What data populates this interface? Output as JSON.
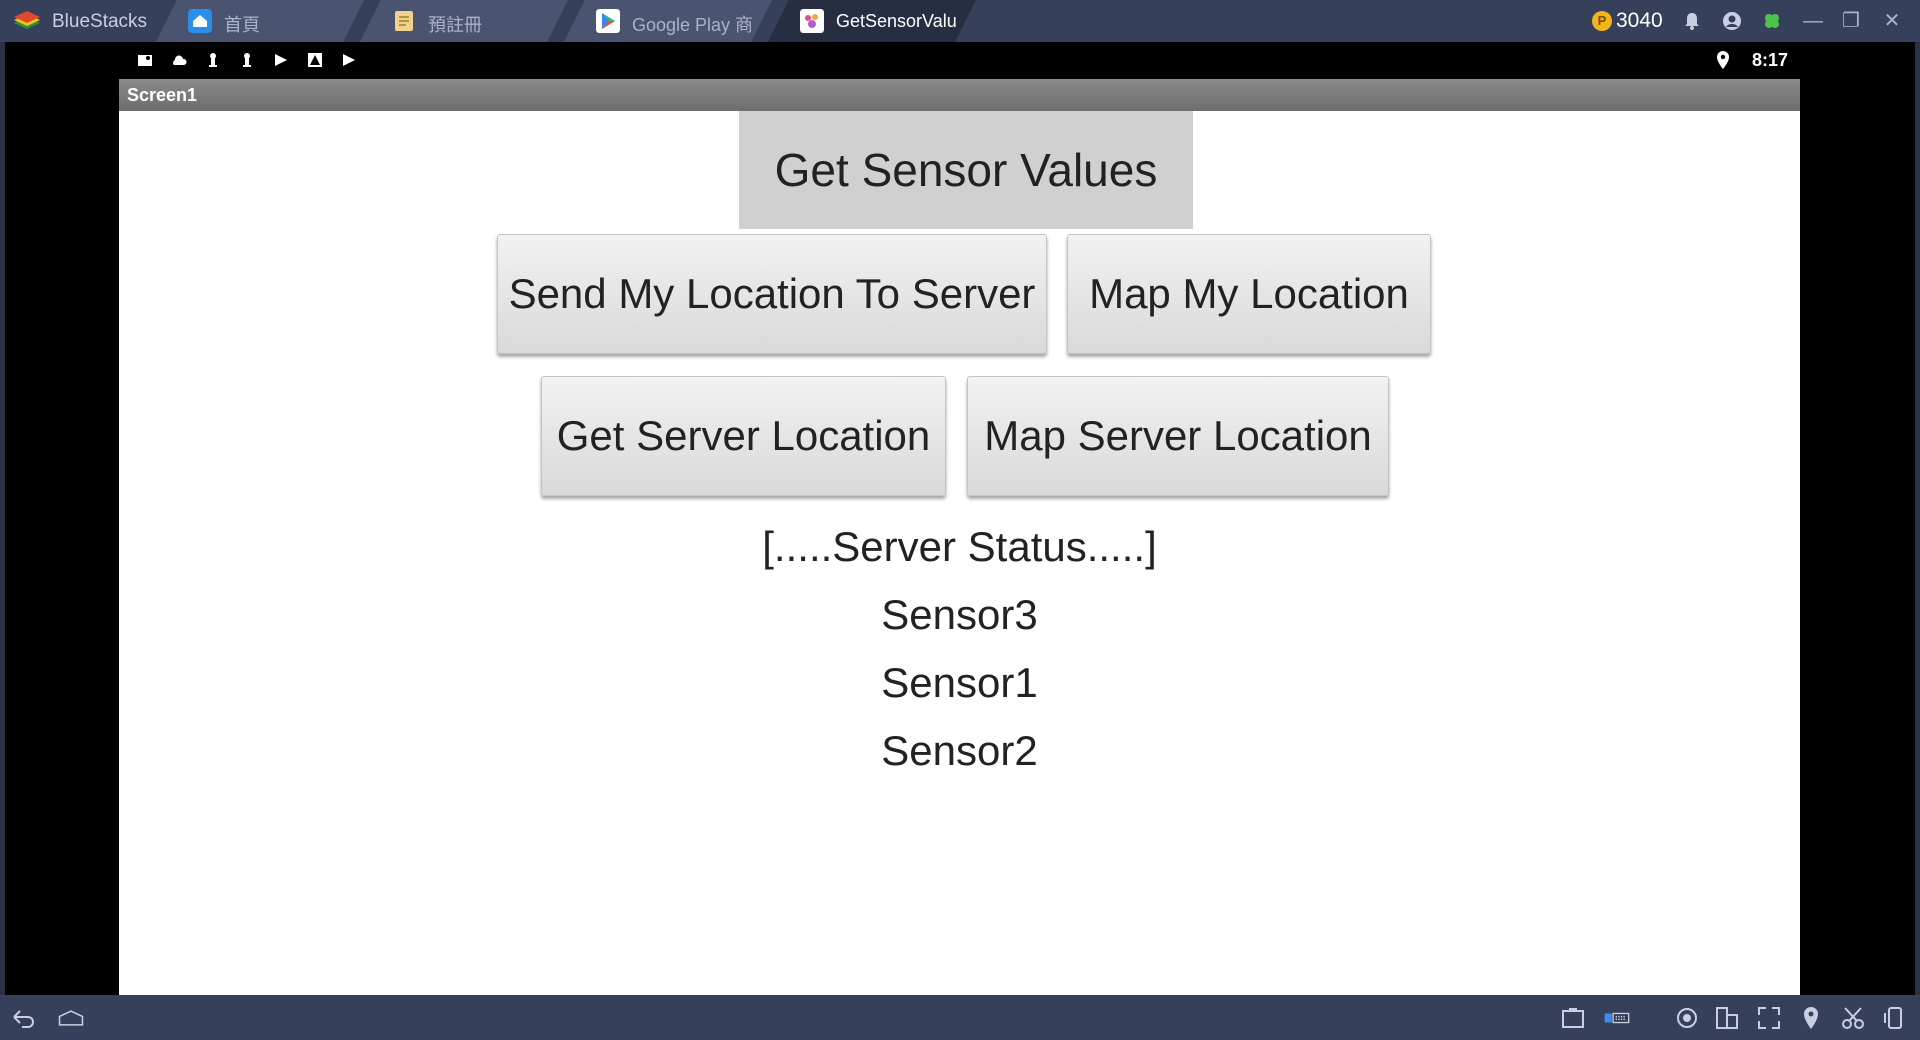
{
  "window": {
    "brand": "BlueStacks",
    "tabs": [
      {
        "label": "首頁"
      },
      {
        "label": "預註冊"
      },
      {
        "label": "Google Play 商店"
      },
      {
        "label": "GetSensorValue"
      }
    ],
    "coin_count": "3040",
    "coin_symbol": "P"
  },
  "android": {
    "time": "8:17"
  },
  "app": {
    "title": "Screen1",
    "get_sensor_button": "Get Sensor Values",
    "send_location_button": "Send My Location To Server",
    "map_my_location_button": "Map My Location",
    "get_server_location_button": "Get Server Location",
    "map_server_location_button": "Map Server Location",
    "server_status": "[.....Server Status.....]",
    "sensors": [
      "Sensor3",
      "Sensor1",
      "Sensor2"
    ]
  },
  "colors": {
    "tabbar": "#37405a",
    "active_tab": "#272e42",
    "app_bg": "#ffffff",
    "primary_button": "#d0d0d0"
  }
}
